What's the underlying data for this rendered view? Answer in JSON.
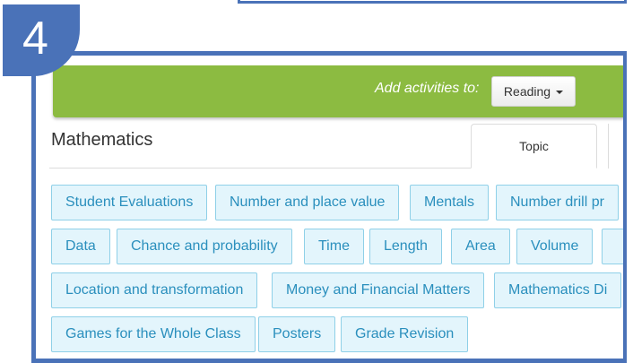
{
  "step": {
    "number": "4"
  },
  "header": {
    "add_label": "Add activities to:",
    "dropdown": {
      "selected": "Reading",
      "icon": "caret-down-icon"
    }
  },
  "subject": {
    "title": "Mathematics"
  },
  "tabs": [
    {
      "label": "Topic",
      "active": true
    }
  ],
  "topics": {
    "row1": [
      "Student Evaluations",
      "Number and place value",
      "Mentals",
      "Number drill pr"
    ],
    "row2": [
      "Data",
      "Chance and probability",
      "Time",
      "Length",
      "Area",
      "Volume"
    ],
    "row3": [
      "Location and transformation",
      "Money and Financial Matters",
      "Mathematics Di"
    ],
    "row4": [
      "Games for the Whole Class",
      "Posters",
      "Grade Revision"
    ]
  },
  "colors": {
    "frame": "#4a72b8",
    "header_green": "#8cbb41",
    "chip_bg": "#e3f5fc",
    "chip_border": "#8fd0e8",
    "chip_text": "#2a8fbd"
  }
}
